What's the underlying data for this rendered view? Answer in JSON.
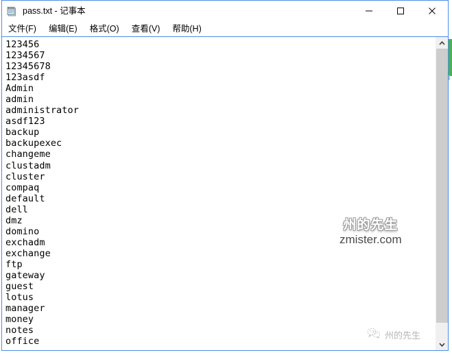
{
  "window": {
    "title": "pass.txt - 记事本",
    "app_icon": "notepad-icon",
    "controls": {
      "minimize_label": "—",
      "maximize_label": "□",
      "close_label": "✕"
    }
  },
  "menubar": {
    "items": [
      {
        "label": "文件(F)",
        "name": "menu-file"
      },
      {
        "label": "编辑(E)",
        "name": "menu-edit"
      },
      {
        "label": "格式(O)",
        "name": "menu-format"
      },
      {
        "label": "查看(V)",
        "name": "menu-view"
      },
      {
        "label": "帮助(H)",
        "name": "menu-help"
      }
    ]
  },
  "document": {
    "lines": [
      "123456",
      "1234567",
      "12345678",
      "123asdf",
      "Admin",
      "admin",
      "administrator",
      "asdf123",
      "backup",
      "backupexec",
      "changeme",
      "clustadm",
      "cluster",
      "compaq",
      "default",
      "dell",
      "dmz",
      "domino",
      "exchadm",
      "exchange",
      "ftp",
      "gateway",
      "guest",
      "lotus",
      "manager",
      "money",
      "notes",
      "office"
    ]
  },
  "scrollbar": {
    "up_arrow": "▲",
    "down_arrow": "▼",
    "thumb_position_percent": 0
  },
  "watermark": {
    "cn_text": "州的先生",
    "en_text": "zmister.com"
  },
  "wechat_badge": {
    "icon": "wechat-icon",
    "label": "州的先生"
  },
  "colors": {
    "window_border": "#4a8ce8",
    "scrollbar_track": "#f0f0f0",
    "scrollbar_thumb": "#cdcdcd",
    "text": "#000000",
    "accent_green": "#4cb050"
  }
}
